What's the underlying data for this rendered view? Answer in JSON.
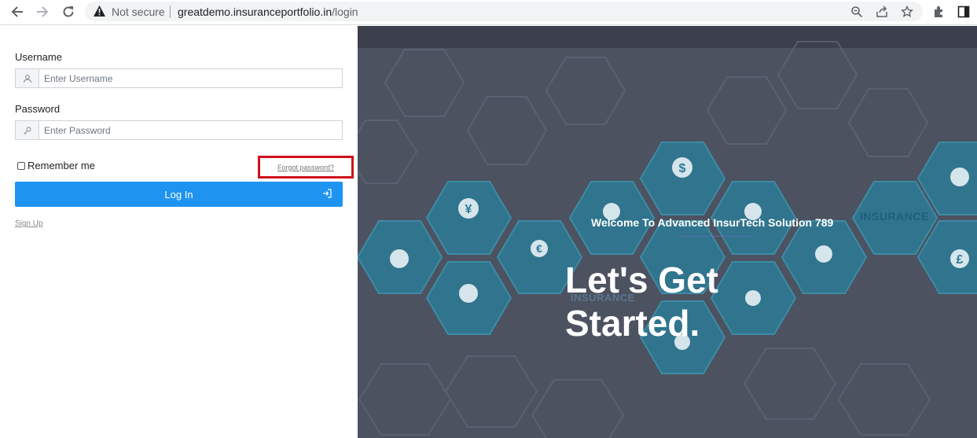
{
  "browser": {
    "security_label": "Not secure",
    "url_domain": "greatdemo.insuranceportfolio.in",
    "url_path": "/login"
  },
  "login": {
    "username_label": "Username",
    "username_placeholder": "Enter Username",
    "password_label": "Password",
    "password_placeholder": "Enter Password",
    "remember_label": "Remember me",
    "forgot_label": "Forgot password?",
    "login_label": "Log In",
    "signup_label": "Sign Up"
  },
  "hero": {
    "welcome": "Welcome To Advanced InsurTech Solution 789",
    "headline": "Let's Get Started.",
    "hex_text_1": "INSURANCE",
    "hex_text_2": "INSURANCE"
  },
  "colors": {
    "primary": "#1e94f0",
    "highlight_border": "#d0101c",
    "hero_bg": "#4c5260",
    "hex_teal": "#2c7a96"
  }
}
